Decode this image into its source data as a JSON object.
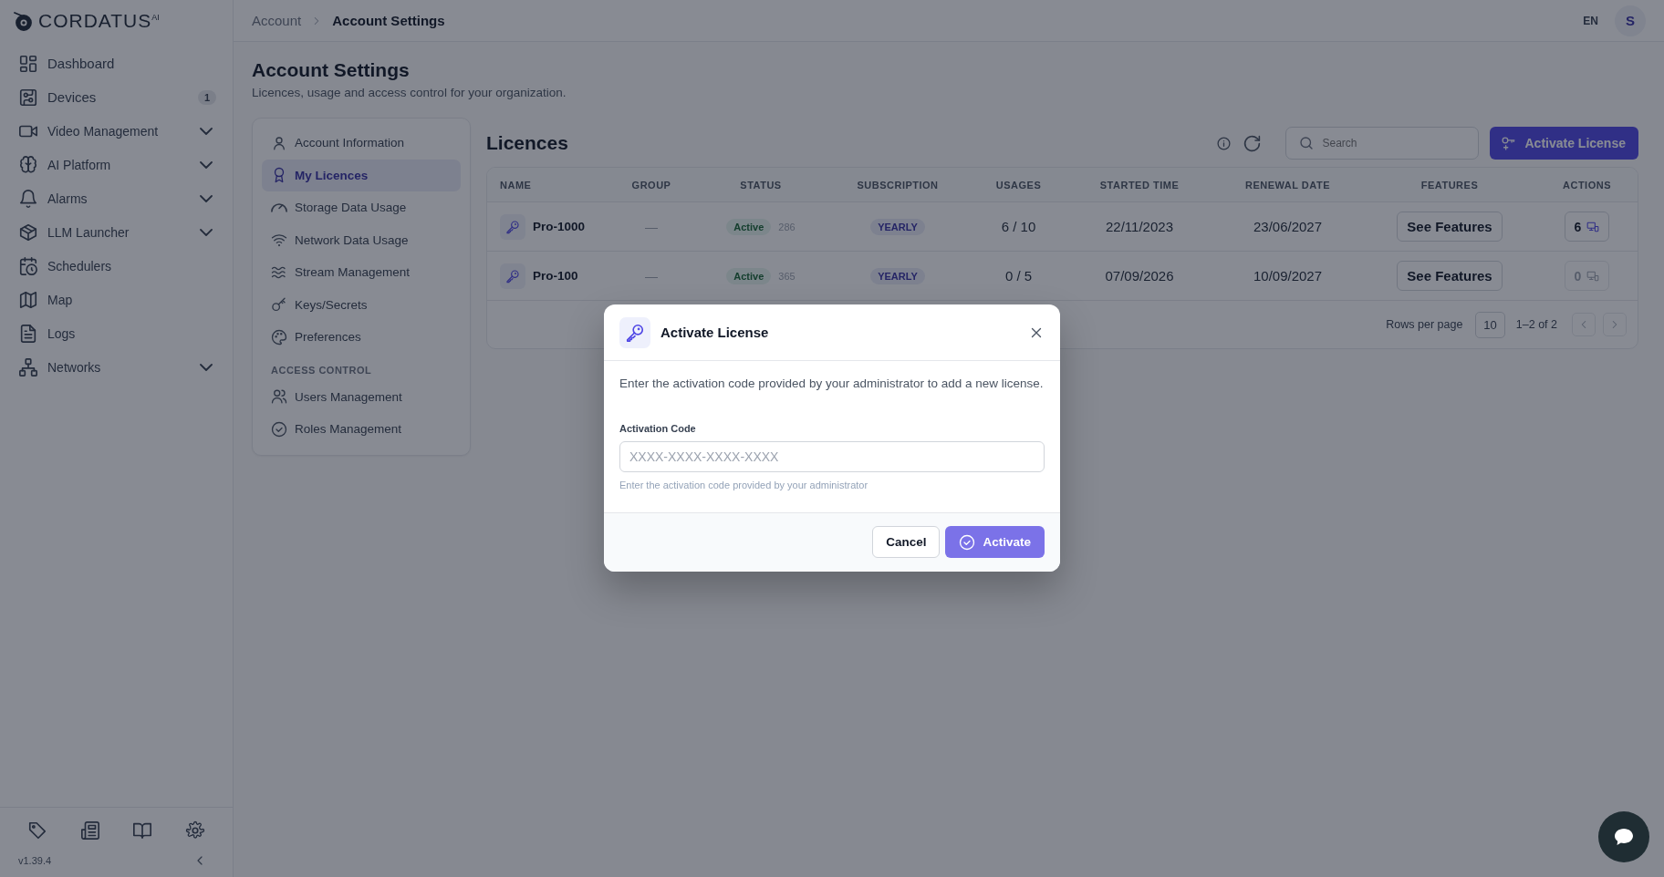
{
  "sidebar": {
    "logo": "CORDATUS$^{AI}$",
    "nav": [
      {
        "label": "Dashboard",
        "expandable": false
      },
      {
        "label": "Devices",
        "badge": "1",
        "expandable": false
      },
      {
        "label": "Video Management",
        "expandable": true
      },
      {
        "label": "AI Platform",
        "expandable": true
      },
      {
        "label": "Alarms",
        "expandable": true
      },
      {
        "label": "LLM Launcher",
        "expandable": true
      },
      {
        "label": "Schedulers",
        "expandable": false
      },
      {
        "label": "Map",
        "expandable": false
      },
      {
        "label": "Logs",
        "expandable": false
      },
      {
        "label": "Networks",
        "expandable": true
      }
    ],
    "version": "v1.39.4"
  },
  "topbar": {
    "breadcrumbs": [
      {
        "label": "Account",
        "current": false
      },
      {
        "label": "Account Settings",
        "current": true
      }
    ],
    "language": "EN",
    "avatar": "S"
  },
  "page": {
    "title": "Account Settings",
    "subtitle": "Licences, usage and access control for your organization."
  },
  "settings_nav": {
    "items": [
      {
        "label": "Account Information",
        "selected": false
      },
      {
        "label": "My Licences",
        "selected": true
      },
      {
        "label": "Storage Data Usage",
        "selected": false
      },
      {
        "label": "Network Data Usage",
        "selected": false
      },
      {
        "label": "Stream Management",
        "selected": false
      },
      {
        "label": "Keys/Secrets",
        "selected": false
      },
      {
        "label": "Preferences",
        "selected": false
      }
    ],
    "section": "ACCESS CONTROL",
    "section_items": [
      {
        "label": "Users Management",
        "selected": false
      },
      {
        "label": "Roles Management",
        "selected": false
      }
    ]
  },
  "licences": {
    "title": "Licences",
    "search_placeholder": "Search",
    "activate_button": "Activate License",
    "columns": [
      "NAME",
      "GROUP",
      "STATUS",
      "SUBSCRIPTION",
      "USAGES",
      "STARTED TIME",
      "RENEWAL DATE",
      "FEATURES",
      "ACTIONS"
    ],
    "rows": [
      {
        "name": "Pro-1000",
        "group": "—",
        "status": "Active",
        "days": "286",
        "subscription": "YEARLY",
        "usages": "6 / 10",
        "started": "22/11/2023",
        "renewal": "23/06/2027",
        "features": "See Features",
        "action_count": "6",
        "action_disabled": false
      },
      {
        "name": "Pro-100",
        "group": "—",
        "status": "Active",
        "days": "365",
        "subscription": "YEARLY",
        "usages": "0 / 5",
        "started": "07/09/2026",
        "renewal": "10/09/2027",
        "features": "See Features",
        "action_count": "0",
        "action_disabled": true
      }
    ],
    "pagination": {
      "label": "Rows per page",
      "rows_per_page": "10",
      "range": "1–2 of 2"
    }
  },
  "modal": {
    "title": "Activate License",
    "description": "Enter the activation code provided by your administrator to add a new license.",
    "field_label": "Activation Code",
    "placeholder": "XXXX-XXXX-XXXX-XXXX",
    "hint": "Enter the activation code provided by your administrator",
    "cancel": "Cancel",
    "submit": "Activate"
  }
}
